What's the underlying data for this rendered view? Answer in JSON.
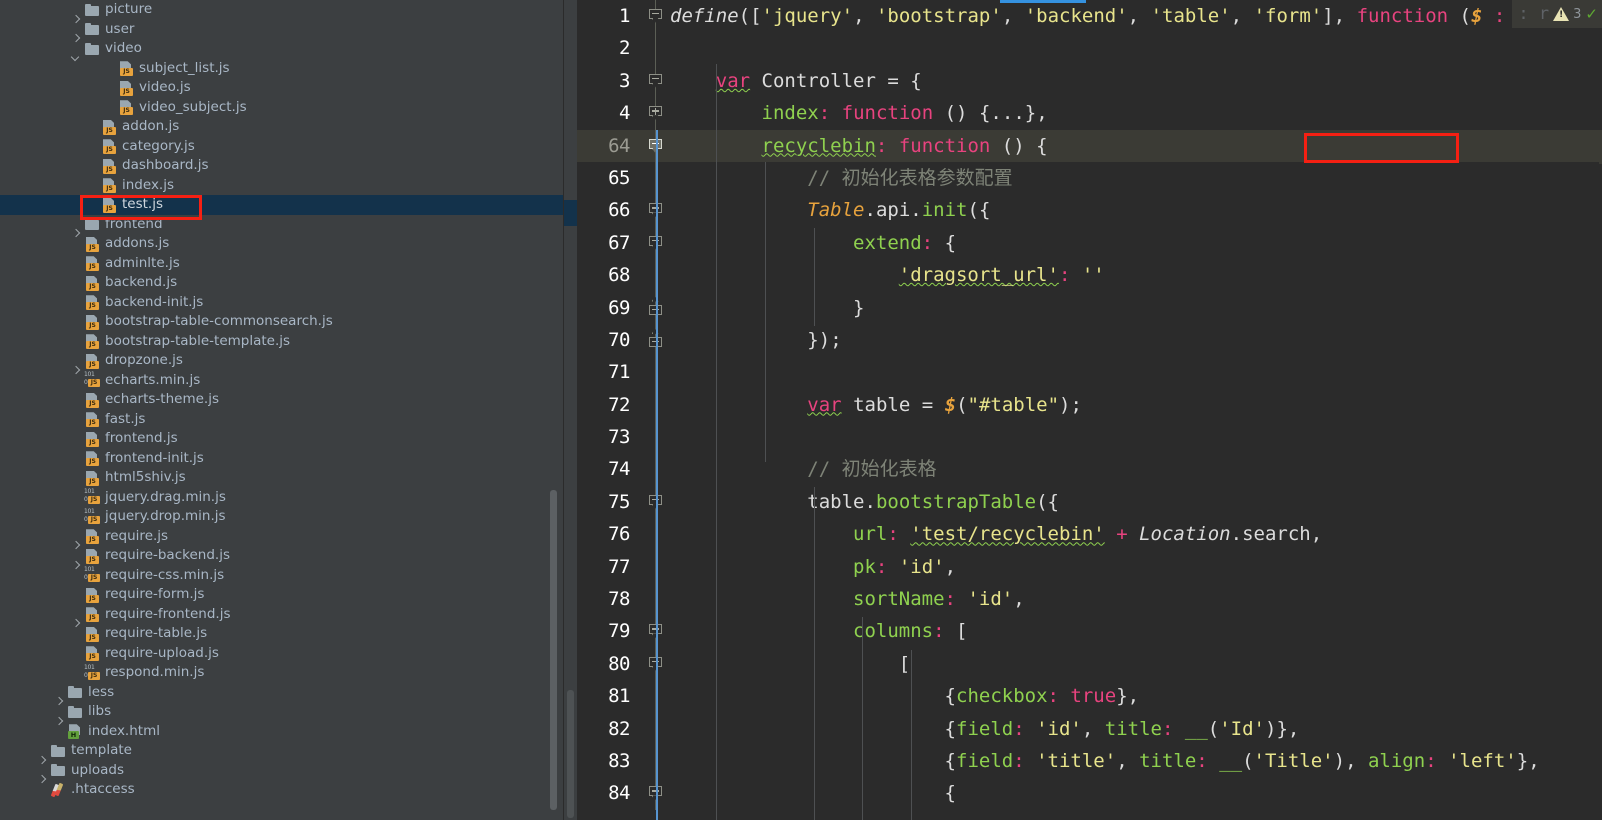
{
  "sidebar": {
    "scrollbar_label": "project-tree-scrollbar",
    "selected_file": "test.js",
    "items": [
      {
        "label": "picture",
        "type": "folder",
        "depth": 2,
        "arrow": "right"
      },
      {
        "label": "user",
        "type": "folder",
        "depth": 2,
        "arrow": "right"
      },
      {
        "label": "video",
        "type": "folder",
        "depth": 2,
        "arrow": "down"
      },
      {
        "label": "subject_list.js",
        "type": "js",
        "depth": 4,
        "arrow": "none"
      },
      {
        "label": "video.js",
        "type": "js",
        "depth": 4,
        "arrow": "none"
      },
      {
        "label": "video_subject.js",
        "type": "js",
        "depth": 4,
        "arrow": "none"
      },
      {
        "label": "addon.js",
        "type": "js",
        "depth": 3,
        "arrow": "none"
      },
      {
        "label": "category.js",
        "type": "js",
        "depth": 3,
        "arrow": "none"
      },
      {
        "label": "dashboard.js",
        "type": "js",
        "depth": 3,
        "arrow": "none"
      },
      {
        "label": "index.js",
        "type": "js",
        "depth": 3,
        "arrow": "none"
      },
      {
        "label": "test.js",
        "type": "js",
        "depth": 3,
        "arrow": "none",
        "selected": true
      },
      {
        "label": "frontend",
        "type": "folder",
        "depth": 2,
        "arrow": "right"
      },
      {
        "label": "addons.js",
        "type": "js",
        "depth": 2,
        "arrow": "none"
      },
      {
        "label": "adminlte.js",
        "type": "js",
        "depth": 2,
        "arrow": "none"
      },
      {
        "label": "backend.js",
        "type": "js",
        "depth": 2,
        "arrow": "none"
      },
      {
        "label": "backend-init.js",
        "type": "js",
        "depth": 2,
        "arrow": "none"
      },
      {
        "label": "bootstrap-table-commonsearch.js",
        "type": "js",
        "depth": 2,
        "arrow": "none"
      },
      {
        "label": "bootstrap-table-template.js",
        "type": "js",
        "depth": 2,
        "arrow": "none"
      },
      {
        "label": "dropzone.js",
        "type": "js",
        "depth": 2,
        "arrow": "right"
      },
      {
        "label": "echarts.min.js",
        "type": "jsmin",
        "depth": 2,
        "arrow": "none"
      },
      {
        "label": "echarts-theme.js",
        "type": "js",
        "depth": 2,
        "arrow": "none"
      },
      {
        "label": "fast.js",
        "type": "js",
        "depth": 2,
        "arrow": "none"
      },
      {
        "label": "frontend.js",
        "type": "js",
        "depth": 2,
        "arrow": "none"
      },
      {
        "label": "frontend-init.js",
        "type": "js",
        "depth": 2,
        "arrow": "none"
      },
      {
        "label": "html5shiv.js",
        "type": "js",
        "depth": 2,
        "arrow": "none"
      },
      {
        "label": "jquery.drag.min.js",
        "type": "jsmin",
        "depth": 2,
        "arrow": "none"
      },
      {
        "label": "jquery.drop.min.js",
        "type": "jsmin",
        "depth": 2,
        "arrow": "none"
      },
      {
        "label": "require.js",
        "type": "js",
        "depth": 2,
        "arrow": "right"
      },
      {
        "label": "require-backend.js",
        "type": "js",
        "depth": 2,
        "arrow": "right"
      },
      {
        "label": "require-css.min.js",
        "type": "jsmin",
        "depth": 2,
        "arrow": "none"
      },
      {
        "label": "require-form.js",
        "type": "js",
        "depth": 2,
        "arrow": "none"
      },
      {
        "label": "require-frontend.js",
        "type": "js",
        "depth": 2,
        "arrow": "right"
      },
      {
        "label": "require-table.js",
        "type": "js",
        "depth": 2,
        "arrow": "none"
      },
      {
        "label": "require-upload.js",
        "type": "js",
        "depth": 2,
        "arrow": "none"
      },
      {
        "label": "respond.min.js",
        "type": "jsmin",
        "depth": 2,
        "arrow": "none"
      },
      {
        "label": "less",
        "type": "folder",
        "depth": 1,
        "arrow": "right"
      },
      {
        "label": "libs",
        "type": "folder",
        "depth": 1,
        "arrow": "right"
      },
      {
        "label": "index.html",
        "type": "html",
        "depth": 1,
        "arrow": "none"
      },
      {
        "label": "template",
        "type": "folder",
        "depth": 0,
        "arrow": "right"
      },
      {
        "label": "uploads",
        "type": "folder",
        "depth": 0,
        "arrow": "right"
      },
      {
        "label": ".htaccess",
        "type": "htaccess",
        "depth": 0,
        "arrow": "none"
      }
    ]
  },
  "editor": {
    "current_line": "64",
    "caret_char": "{",
    "inspection": {
      "warning_count": "3",
      "warning_icon": "warning-triangle-icon",
      "ok_icon": "green-check-icon",
      "hidden_text": ": r"
    },
    "lines": [
      {
        "num": "1",
        "fold": "down",
        "current": false
      },
      {
        "num": "2",
        "fold": "none",
        "current": false
      },
      {
        "num": "3",
        "fold": "down",
        "current": false
      },
      {
        "num": "4",
        "fold": "plus",
        "current": false
      },
      {
        "num": "64",
        "fold": "filled",
        "current": true
      },
      {
        "num": "65",
        "fold": "none",
        "current": false
      },
      {
        "num": "66",
        "fold": "down",
        "current": false
      },
      {
        "num": "67",
        "fold": "down",
        "current": false
      },
      {
        "num": "68",
        "fold": "none",
        "current": false
      },
      {
        "num": "69",
        "fold": "up",
        "current": false
      },
      {
        "num": "70",
        "fold": "up",
        "current": false
      },
      {
        "num": "71",
        "fold": "none",
        "current": false
      },
      {
        "num": "72",
        "fold": "none",
        "current": false
      },
      {
        "num": "73",
        "fold": "none",
        "current": false
      },
      {
        "num": "74",
        "fold": "none",
        "current": false
      },
      {
        "num": "75",
        "fold": "down",
        "current": false
      },
      {
        "num": "76",
        "fold": "none",
        "current": false
      },
      {
        "num": "77",
        "fold": "none",
        "current": false
      },
      {
        "num": "78",
        "fold": "none",
        "current": false
      },
      {
        "num": "79",
        "fold": "down",
        "current": false
      },
      {
        "num": "80",
        "fold": "down",
        "current": false
      },
      {
        "num": "81",
        "fold": "none",
        "current": false
      },
      {
        "num": "82",
        "fold": "none",
        "current": false
      },
      {
        "num": "83",
        "fold": "none",
        "current": false
      },
      {
        "num": "84",
        "fold": "down",
        "current": false
      }
    ],
    "source_text": [
      "define(['jquery', 'bootstrap', 'backend', 'table', 'form'], function ($ : r",
      "",
      "    var Controller = {",
      "        index: function () {...},",
      "        recyclebin: function () {",
      "            // 初始化表格参数配置",
      "            Table.api.init({",
      "                extend: {",
      "                    'dragsort_url': ''",
      "                }",
      "            });",
      "",
      "            var table = $(\"#table\");",
      "",
      "            // 初始化表格",
      "            table.bootstrapTable({",
      "                url: 'test/recyclebin' + Location.search,",
      "                pk: 'id',",
      "                sortName: 'id',",
      "                columns: [",
      "                    [",
      "                        {checkbox: true},",
      "                        {field: 'id', title: __('Id')},",
      "                        {field: 'title', title: __('Title'), align: 'left'},",
      "                        {"
    ],
    "annotations": [
      {
        "name": "test-js-highlight-box",
        "color": "#f52013"
      },
      {
        "name": "recyclebin-highlight-box",
        "color": "#f52013"
      }
    ]
  }
}
